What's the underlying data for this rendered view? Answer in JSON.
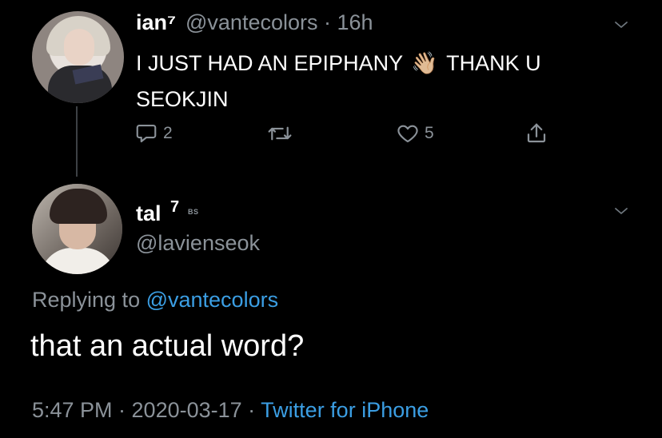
{
  "tweet1": {
    "name": "ian⁷",
    "handle_time": "@vantecolors · 16h",
    "text_line1": "I JUST HAD AN EPIPHANY",
    "emoji": "👋🏼",
    "text_line1_end": "THANK U",
    "text_line2": "SEOKJIN",
    "reply_count": "2",
    "like_count": "5"
  },
  "tweet2": {
    "name": "tal",
    "name_sup": "7",
    "badge": "BS",
    "handle": "@lavienseok",
    "replying_prefix": "Replying to ",
    "replying_handle": "@vantecolors",
    "text": "that an actual word?",
    "time_date": "5:47 PM · 2020-03-17 · ",
    "source": "Twitter for iPhone"
  },
  "colors": {
    "background": "#000000",
    "secondary_text": "#8b9299",
    "link": "#3b9ee3",
    "thread_line": "#3d4145"
  },
  "icons": [
    "chevron-down-icon",
    "reply-icon",
    "retweet-icon",
    "like-icon",
    "share-icon"
  ]
}
